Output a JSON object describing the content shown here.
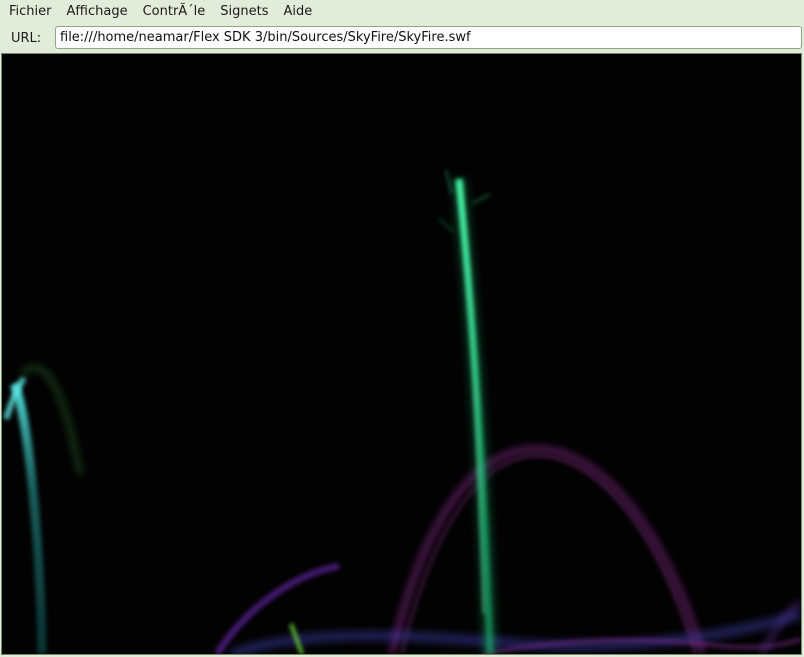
{
  "menu": {
    "items": [
      "Fichier",
      "Affichage",
      "ContrÃ´le",
      "Signets",
      "Aide"
    ]
  },
  "urlbar": {
    "label": "URL:",
    "value": "file:///home/neamar/Flex SDK 3/bin/Sources/SkyFire/SkyFire.swf"
  },
  "stage": {
    "background": "#020202",
    "colors": {
      "green_trail": "#1ee38f",
      "teal_trail": "#3ad6d2",
      "purple_trail": "#8a2a8e",
      "violet_trail": "#6a2ab4",
      "lime_trail": "#6ee23a"
    }
  }
}
